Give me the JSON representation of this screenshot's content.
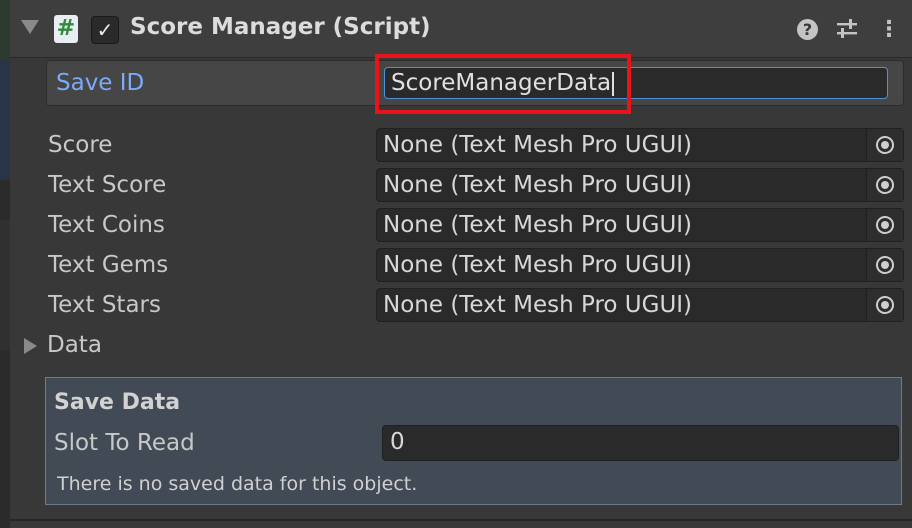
{
  "component": {
    "title": "Score Manager (Script)",
    "script_icon_glyph": "#",
    "enabled_glyph": "✓",
    "help_glyph": "?",
    "menu_glyph": "⋮"
  },
  "save_id": {
    "label": "Save ID",
    "value": "ScoreManagerData"
  },
  "fields": [
    {
      "label": "Score",
      "value": "None (Text Mesh Pro UGUI)"
    },
    {
      "label": "Text Score",
      "value": "None (Text Mesh Pro UGUI)"
    },
    {
      "label": "Text Coins",
      "value": "None (Text Mesh Pro UGUI)"
    },
    {
      "label": "Text Gems",
      "value": "None (Text Mesh Pro UGUI)"
    },
    {
      "label": "Text Stars",
      "value": "None (Text Mesh Pro UGUI)"
    }
  ],
  "data_foldout": {
    "label": "Data"
  },
  "save_data": {
    "title": "Save Data",
    "slot_label": "Slot To Read",
    "slot_value": "0",
    "message": "There is no saved data for this object."
  },
  "colors": {
    "background": "#383838",
    "label_accent": "#7baaf7",
    "highlight": "#e8141a",
    "input_focus": "#4f8fd6",
    "panel": "#414a55"
  }
}
